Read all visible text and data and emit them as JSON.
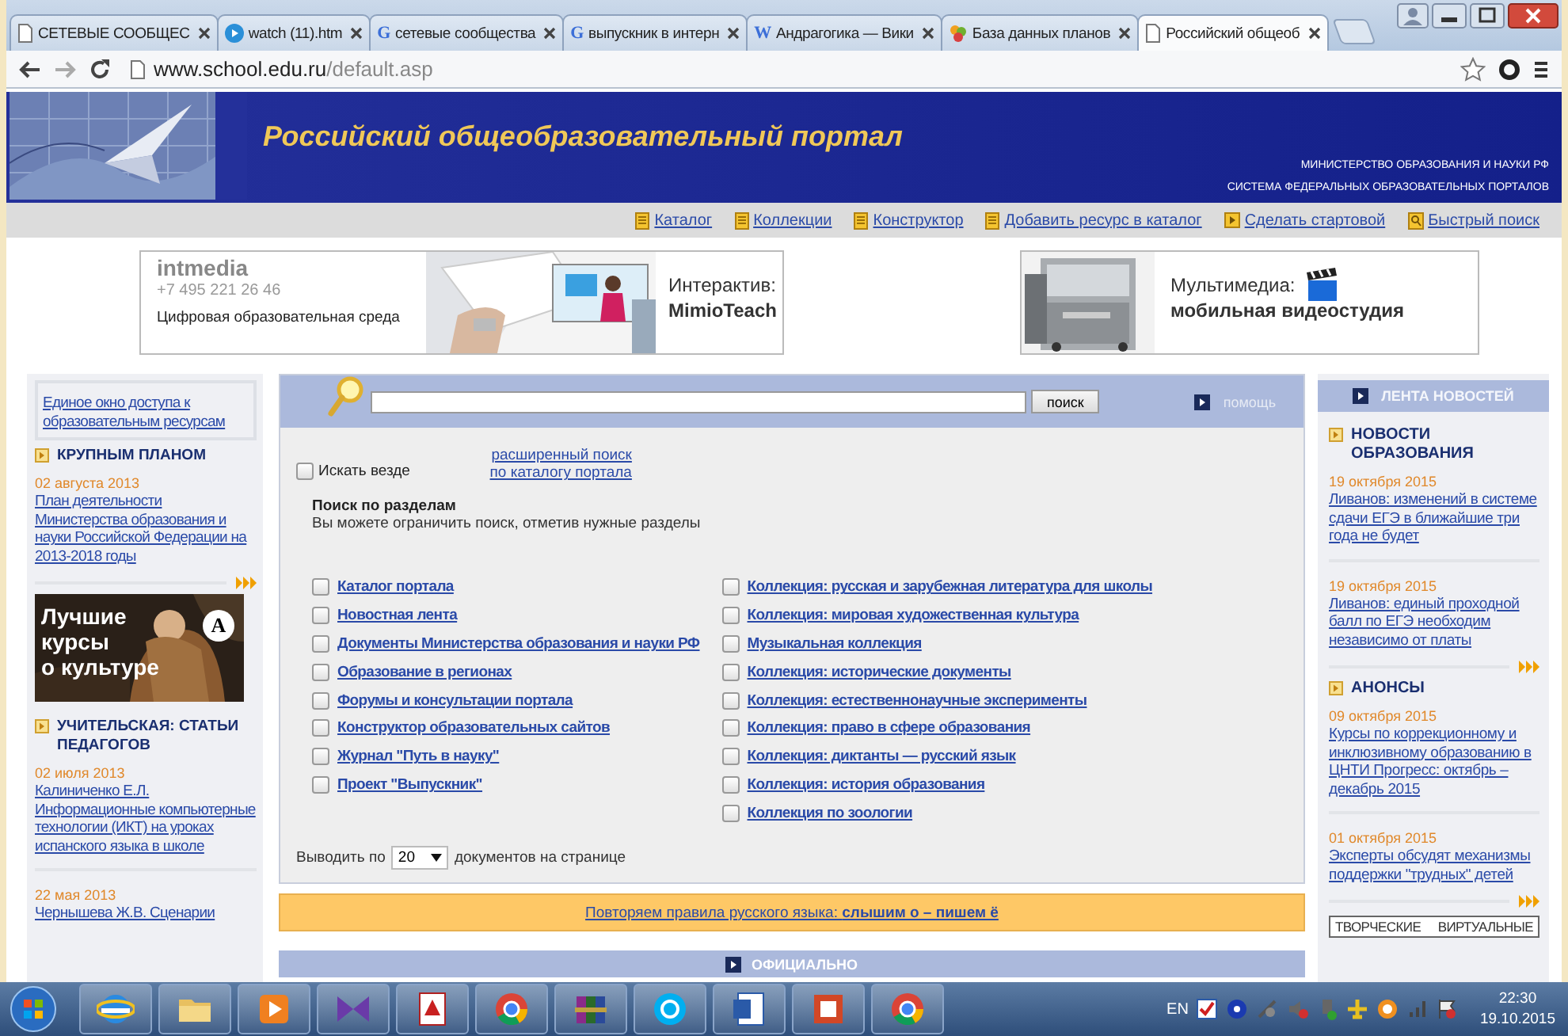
{
  "browser": {
    "tabs": [
      {
        "title": "СЕТЕВЫЕ СООБЩЕС",
        "selected": false
      },
      {
        "title": "watch (11).htm",
        "selected": false
      },
      {
        "title": "сетевые сообщества",
        "glyph": "G",
        "selected": false
      },
      {
        "title": "выпускник в интерн",
        "glyph": "G",
        "selected": false
      },
      {
        "title": "Андрагогика — Вики",
        "glyph": "W",
        "selected": false
      },
      {
        "title": "База данных планов",
        "selected": false
      },
      {
        "title": "Российский общеоб",
        "selected": true
      }
    ],
    "address": {
      "host": "www.school.edu.ru",
      "path": "/default.asp"
    }
  },
  "header": {
    "title": "Российский общеобразовательный портал",
    "org_lines": [
      "МИНИСТЕРСТВО ОБРАЗОВАНИЯ И НАУКИ РФ",
      "СИСТЕМА ФЕДЕРАЛЬНЫХ ОБРАЗОВАТЕЛЬНЫХ ПОРТАЛОВ"
    ]
  },
  "nav": [
    "Каталог",
    "Коллекции",
    "Конструктор",
    "Добавить ресурс в каталог",
    "Сделать стартовой",
    "Быстрый поиск"
  ],
  "banners": [
    {
      "kind": "intmedia",
      "logo": "intmedia",
      "phone": "+7 495 221 26 46",
      "tagline": "Цифровая образовательная среда",
      "caption": "Интерактив:",
      "product": "MimioTeach"
    },
    {
      "kind": "studio",
      "caption": "Мультимедиа:",
      "product": "мобильная видеостудия"
    }
  ],
  "left": [
    {
      "kind": "link_box",
      "text": "Единое окно доступа к образовательным ресурсам"
    },
    {
      "kind": "heading",
      "text": "КРУПНЫМ ПЛАНОМ"
    },
    {
      "kind": "news",
      "date": "02 августа 2013",
      "text": "План деятельности Министерства образования и науки Российской Федерации на 2013-2018 годы"
    },
    {
      "kind": "more"
    },
    {
      "kind": "ad",
      "lines": [
        "Лучшие",
        "курсы",
        "о культуре"
      ],
      "logo": "А"
    },
    {
      "kind": "heading",
      "text": "УЧИТЕЛЬСКАЯ: СТАТЬИ ПЕДАГОГОВ"
    },
    {
      "kind": "news",
      "date": "02 июля 2013",
      "text": "Калиниченко Е.Л. Информационные компьютерные технологии (ИКТ) на уроках испанского языка в школе"
    },
    {
      "kind": "rule"
    },
    {
      "kind": "news",
      "date": "22 мая 2013",
      "text": "Чернышева Ж.В. Сценарии"
    }
  ],
  "search": {
    "button": "поиск",
    "help": "помощь",
    "everywhere": {
      "label": "Искать везде",
      "checked": false
    },
    "advanced": "расширенный поиск по каталогу портала",
    "sections_title": "Поиск по разделам",
    "sections_hint": "Вы можете ограничить поиск, отметив нужные разделы",
    "sections": [
      [
        {
          "label": "Каталог портала",
          "checked": false
        },
        {
          "label": "Новостная лента",
          "checked": false
        },
        {
          "label": "Документы Министерства образования и науки РФ",
          "checked": false
        },
        {
          "label": "Образование в регионах",
          "checked": false
        },
        {
          "label": "Форумы и консультации портала",
          "checked": false
        },
        {
          "label": "Конструктор образовательных сайтов",
          "checked": false
        },
        {
          "label": "Журнал \"Путь в науку\"",
          "checked": false
        },
        {
          "label": "Проект \"Выпускник\"",
          "checked": false
        }
      ],
      [
        {
          "label": "Коллекция: русская и зарубежная литература для школы",
          "checked": false
        },
        {
          "label": "Коллекция: мировая художественная культура",
          "checked": false
        },
        {
          "label": "Музыкальная коллекция",
          "checked": false
        },
        {
          "label": "Коллекция: исторические документы",
          "checked": false
        },
        {
          "label": "Коллекция: естественнонаучные эксперименты",
          "checked": false
        },
        {
          "label": "Коллекция: право в сфере образования",
          "checked": false
        },
        {
          "label": "Коллекция: диктанты — русский язык",
          "checked": false
        },
        {
          "label": "Коллекция: история образования",
          "checked": false
        },
        {
          "label": "Коллекция по зоологии",
          "checked": false
        }
      ]
    ],
    "page_size": {
      "before": "Выводить по",
      "value": "20",
      "after": "документов на странице"
    }
  },
  "notice": "Повторяем правила русского языка: **слышим о – пишем ё**",
  "official": "ОФИЦИАЛЬНО",
  "right": {
    "title": "ЛЕНТА НОВОСТЕЙ",
    "blocks": [
      {
        "kind": "heading",
        "text": "НОВОСТИ ОБРАЗОВАНИЯ"
      },
      {
        "kind": "news",
        "date": "19 октября 2015",
        "text": "Ливанов: изменений в системе сдачи ЕГЭ в ближайшие три года не будет"
      },
      {
        "kind": "rule"
      },
      {
        "kind": "news",
        "date": "19 октября 2015",
        "text": "Ливанов: единый проходной балл по ЕГЭ необходим независимо от платы"
      },
      {
        "kind": "more"
      },
      {
        "kind": "heading",
        "text": "АНОНСЫ"
      },
      {
        "kind": "news",
        "date": "09 октября 2015",
        "text": "Курсы по коррекционному и инклюзивному образованию в ЦНТИ Прогресс: октябрь – декабрь 2015"
      },
      {
        "kind": "rule"
      },
      {
        "kind": "news",
        "date": "01 октября 2015",
        "text": "Эксперты обсудят механизмы поддержки \"трудных\" детей"
      },
      {
        "kind": "more"
      },
      {
        "kind": "promo",
        "words": [
          "ТВОРЧЕСКИЕ",
          "ВИРТУАЛЬНЫЕ"
        ]
      }
    ]
  },
  "taskbar": {
    "lang": "EN",
    "time": "22:30",
    "date": "19.10.2015"
  }
}
